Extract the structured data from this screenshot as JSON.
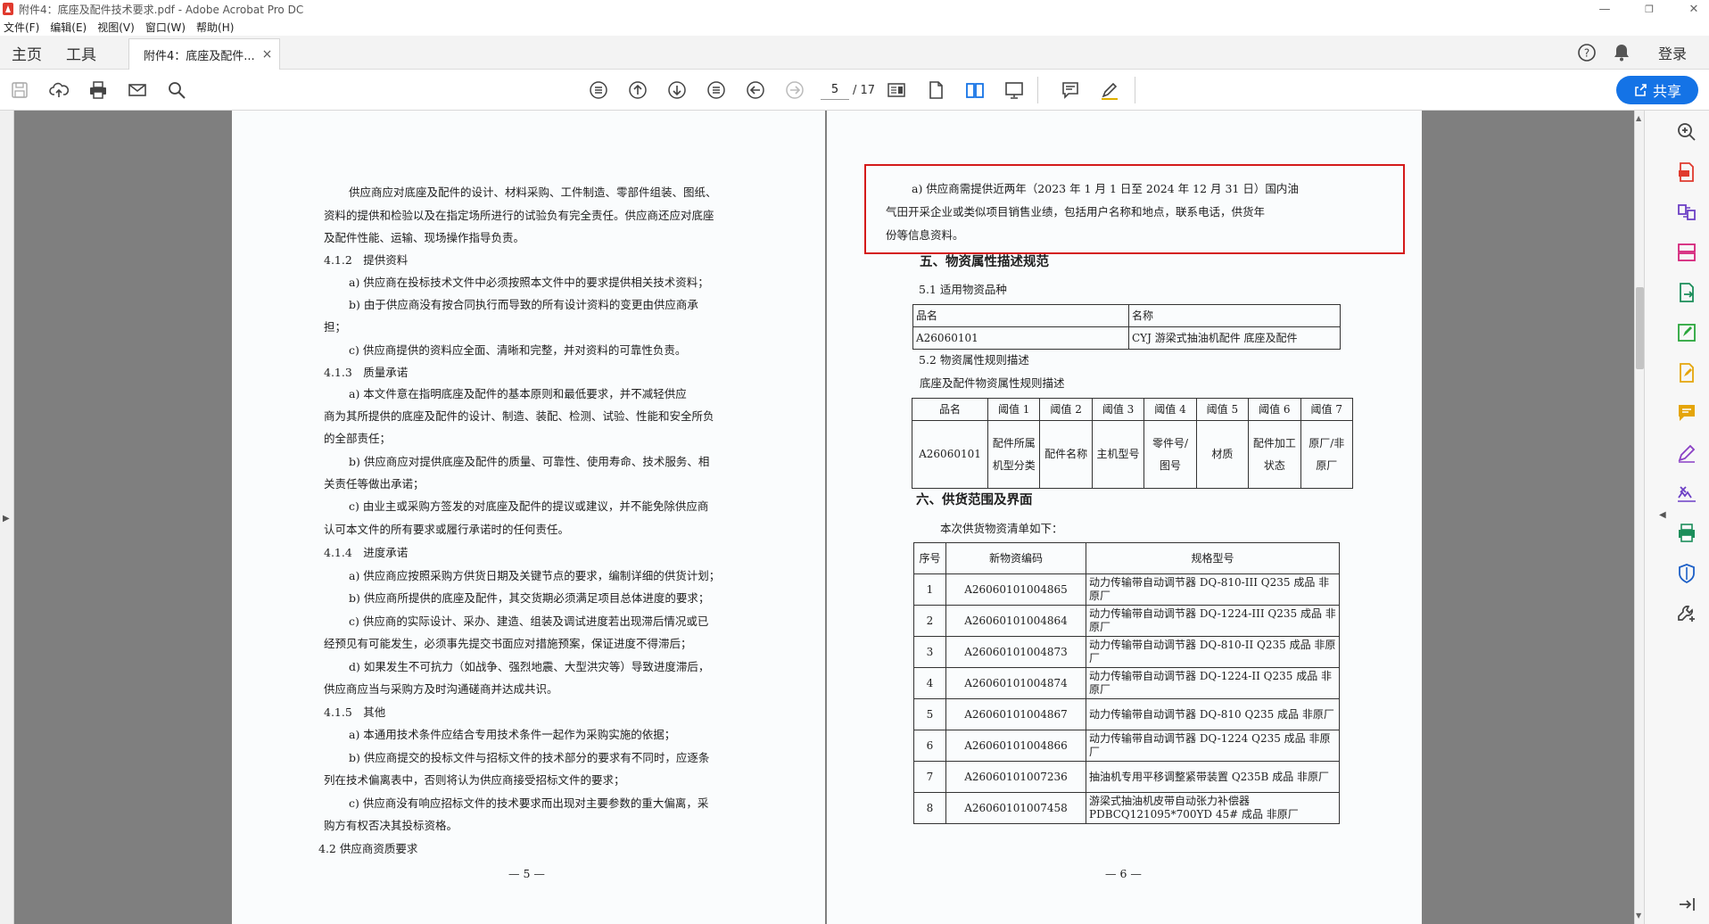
{
  "window": {
    "title": "附件4：底座及配件技术要求.pdf - Adobe Acrobat Pro DC"
  },
  "menu": {
    "items": [
      "文件(F)",
      "编辑(E)",
      "视图(V)",
      "窗口(W)",
      "帮助(H)"
    ]
  },
  "tabs": {
    "home": "主页",
    "tools": "工具",
    "document": "附件4：底座及配件...",
    "close": "×",
    "login": "登录"
  },
  "toolbar": {
    "current_page": "5",
    "total_pages": "/ 17",
    "share_label": "共享"
  },
  "page5": {
    "lines": [
      "供应商应对底座及配件的设计、材料采购、工件制造、零部件组装、图纸、",
      "资料的提供和检验以及在指定场所进行的试验负有完全责任。供应商还应对底座",
      "及配件性能、运输、现场操作指导负责。",
      "4.1.2　提供资料",
      "a) 供应商在投标技术文件中必须按照本文件中的要求提供相关技术资料；",
      "b) 由于供应商没有按合同执行而导致的所有设计资料的变更由供应商承",
      "担；",
      "c) 供应商提供的资料应全面、清晰和完整，并对资料的可靠性负责。",
      "4.1.3　质量承诺",
      "a) 本文件意在指明底座及配件的基本原则和最低要求，并不减轻供应",
      "商为其所提供的底座及配件的设计、制造、装配、检测、试验、性能和安全所负",
      "的全部责任；",
      "b) 供应商应对提供底座及配件的质量、可靠性、使用寿命、技术服务、相",
      "关责任等做出承诺；",
      "c) 由业主或采购方签发的对底座及配件的提议或建议，并不能免除供应商",
      "认可本文件的所有要求或履行承诺时的任何责任。",
      "4.1.4　进度承诺",
      "a) 供应商应按照采购方供货日期及关键节点的要求，编制详细的供货计划；",
      "b) 供应商所提供的底座及配件，其交货期必须满足项目总体进度的要求；",
      "c) 供应商的实际设计、采办、建造、组装及调试进度若出现滞后情况或已",
      "经预见有可能发生，必须事先提交书面应对措施预案，保证进度不得滞后；",
      "d) 如果发生不可抗力（如战争、强烈地震、大型洪灾等）导致进度滞后，",
      "供应商应当与采购方及时沟通磋商并达成共识。",
      "4.1.5　其他",
      "a) 本通用技术条件应结合专用技术条件一起作为采购实施的依据；",
      "b) 供应商提交的投标文件与招标文件的技术部分的要求有不同时，应逐条",
      "列在技术偏离表中，否则将认为供应商接受招标文件的要求；",
      "c) 供应商没有响应招标文件的技术要求而出现对主要参数的重大偏离，采",
      "购方有权否决其投标资格。",
      "4.2 供应商资质要求"
    ],
    "page_number": "— 5 —"
  },
  "page6": {
    "highlight_lines": [
      "a) 供应商需提供近两年（2023 年 1 月 1 日至 2024 年 12 月 31 日）国内油",
      "气田开采企业或类似项目销售业绩，包括用户名称和地点，联系电话，供货年",
      "份等信息资料。"
    ],
    "section5_title": "五、物资属性描述规范",
    "s51": "5.1 适用物资品种",
    "t1": {
      "headers": [
        "品名",
        "名称"
      ],
      "row": [
        "A26060101",
        "CYJ 游梁式抽油机配件 底座及配件"
      ]
    },
    "s52": "5.2 物资属性规则描述",
    "s52_sub": "底座及配件物资属性规则描述",
    "t2": {
      "headers": [
        "品名",
        "阈值 1",
        "阈值 2",
        "阈值 3",
        "阈值 4",
        "阈值 5",
        "阈值 6",
        "阈值 7"
      ],
      "row": [
        "A26060101",
        "配件所属机型分类",
        "配件名称",
        "主机型号",
        "零件号/图号",
        "材质",
        "配件加工状态",
        "原厂/非原厂"
      ]
    },
    "section6_title": "六、供货范围及界面",
    "list_intro": "本次供货物资清单如下：",
    "t3": {
      "headers": [
        "序号",
        "新物资编码",
        "规格型号"
      ],
      "rows": [
        [
          "1",
          "A26060101004865",
          "动力传输带自动调节器 DQ-810-III Q235 成品 非原厂"
        ],
        [
          "2",
          "A26060101004864",
          "动力传输带自动调节器 DQ-1224-III Q235 成品 非原厂"
        ],
        [
          "3",
          "A26060101004873",
          "动力传输带自动调节器 DQ-810-II Q235 成品 非原厂"
        ],
        [
          "4",
          "A26060101004874",
          "动力传输带自动调节器 DQ-1224-II Q235 成品 非原厂"
        ],
        [
          "5",
          "A26060101004867",
          "动力传输带自动调节器 DQ-810 Q235 成品 非原厂"
        ],
        [
          "6",
          "A26060101004866",
          "动力传输带自动调节器 DQ-1224 Q235 成品 非原厂"
        ],
        [
          "7",
          "A26060101007236",
          "抽油机专用平移调整紧带装置 Q235B 成品 非原厂"
        ],
        [
          "8",
          "A26060101007458",
          "游梁式抽油机皮带自动张力补偿器 PDBCQ121095*700YD 45# 成品 非原厂"
        ]
      ]
    },
    "page_number": "— 6 —"
  },
  "colors": {
    "accent": "#1473e6",
    "highlight_border": "#d41a1a",
    "workspace_bg": "#7f7f7f"
  }
}
